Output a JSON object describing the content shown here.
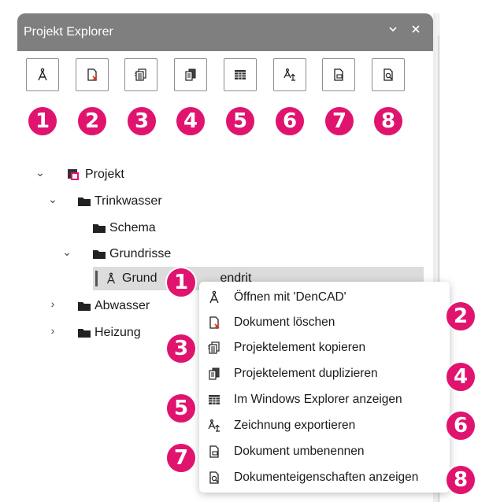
{
  "panel": {
    "title": "Projekt Explorer",
    "collapse_icon": "chevron-down-icon",
    "close_icon": "close-icon"
  },
  "toolbar": {
    "buttons": [
      {
        "icon": "compass-icon",
        "badge": "1"
      },
      {
        "icon": "delete-document-icon",
        "badge": "2"
      },
      {
        "icon": "copy-element-icon",
        "badge": "3"
      },
      {
        "icon": "duplicate-icon",
        "badge": "4"
      },
      {
        "icon": "windows-explorer-icon",
        "badge": "5"
      },
      {
        "icon": "export-drawing-icon",
        "badge": "6"
      },
      {
        "icon": "rename-document-icon",
        "badge": "7"
      },
      {
        "icon": "document-properties-icon",
        "badge": "8"
      }
    ]
  },
  "tree": {
    "root": "Projekt",
    "trinkwasser": "Trinkwasser",
    "schema": "Schema",
    "grundrisse": "Grundrisse",
    "selected_prefix": "Grund",
    "selected_suffix": "endrit",
    "abwasser": "Abwasser",
    "heizung": "Heizung"
  },
  "context_menu": {
    "items": [
      {
        "label": "Öffnen mit 'DenCAD'",
        "icon": "compass-icon",
        "badge": "1"
      },
      {
        "label": "Dokument löschen",
        "icon": "delete-document-icon",
        "badge": "2"
      },
      {
        "label": "Projektelement kopieren",
        "icon": "copy-element-icon",
        "badge": "3"
      },
      {
        "label": "Projektelement duplizieren",
        "icon": "duplicate-icon",
        "badge": "4"
      },
      {
        "label": "Im Windows Explorer anzeigen",
        "icon": "windows-explorer-icon",
        "badge": "5"
      },
      {
        "label": "Zeichnung exportieren",
        "icon": "export-drawing-icon",
        "badge": "6"
      },
      {
        "label": "Dokument umbenennen",
        "icon": "rename-document-icon",
        "badge": "7"
      },
      {
        "label": "Dokumenteigenschaften anzeigen",
        "icon": "document-properties-icon",
        "badge": "8"
      }
    ]
  },
  "colors": {
    "badge": "#e0146f",
    "titlebar": "#7f7f7f",
    "selection": "#dcdcdc"
  }
}
